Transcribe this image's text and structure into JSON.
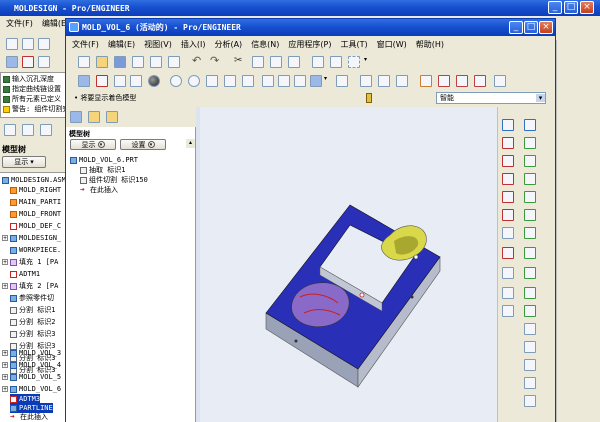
{
  "bg_window": {
    "title": "MOLDESIGN - Pro/ENGINEER",
    "menu": [
      "文件(F)",
      "编辑(E)"
    ],
    "messages": [
      "输入沉孔深度",
      "指定曲线链设置",
      "所有元素已定义",
      "警告: 组件切割完"
    ],
    "model_tree_label": "模型树",
    "show_label": "显示",
    "tree": [
      {
        "icon": "plane",
        "label": "MOLD_RIGHT"
      },
      {
        "icon": "plane",
        "label": "MAIN_PARTI"
      },
      {
        "icon": "plane",
        "label": "MOLD_FRONT"
      },
      {
        "icon": "axis",
        "label": "MOLD_DEF_C"
      },
      {
        "icon": "part",
        "label": "MOLDESIGN_"
      },
      {
        "icon": "part",
        "label": "WORKPIECE."
      },
      {
        "icon": "fill",
        "label": "填充 1 [PA"
      },
      {
        "icon": "axis",
        "label": "ADTM1"
      },
      {
        "icon": "fill",
        "label": "填充 2 [PA"
      },
      {
        "icon": "part",
        "label": "参照零件切"
      },
      {
        "icon": "cut",
        "label": "分割 标识1"
      },
      {
        "icon": "cut",
        "label": "分割 标识2"
      },
      {
        "icon": "cut",
        "label": "分割 标识3"
      },
      {
        "icon": "cut",
        "label": "分割 标识3"
      },
      {
        "icon": "cut",
        "label": "分割 标识3"
      },
      {
        "icon": "cut",
        "label": "分割 标识3"
      },
      {
        "icon": "part",
        "label": "MOLD_VOL_3"
      },
      {
        "icon": "part",
        "label": "MOLD_VOL_4"
      },
      {
        "icon": "part",
        "label": "MOLD_VOL_5"
      },
      {
        "icon": "part",
        "label": "MOLD_VOL_6"
      },
      {
        "icon": "axis",
        "label": "ADTM3"
      },
      {
        "icon": "part",
        "label": "PARTLINE"
      },
      {
        "icon": "arrow",
        "label": "在此插入"
      }
    ],
    "top_root": "MOLDESIGN.ASM"
  },
  "window": {
    "title": "MOLD_VOL_6 (活动的) - Pro/ENGINEER",
    "menu": [
      "文件(F)",
      "编辑(E)",
      "视图(V)",
      "插入(I)",
      "分析(A)",
      "信息(N)",
      "应用程序(P)",
      "工具(T)",
      "窗口(W)",
      "帮助(H)"
    ],
    "status_message": "• 将要显示着色模型",
    "filter_value": "智能",
    "model_tree_label": "模型树",
    "show_button": "显示",
    "settings_button": "设置",
    "tree": [
      {
        "icon": "part",
        "label": "MOLD_VOL_6.PRT",
        "indent": 0
      },
      {
        "icon": "cut",
        "label": "抽取 标识1",
        "indent": 1
      },
      {
        "icon": "cut",
        "label": "组件切割 标识150",
        "indent": 1
      },
      {
        "icon": "arrow",
        "label": "在此插入",
        "indent": 1
      }
    ]
  },
  "colors": {
    "title_blue": "#1850d0",
    "viewport_bg": "#e8ecf4",
    "model_top": "#2a2fb8",
    "model_side": "#a9b0c4",
    "accent_yellow": "#d8d84a",
    "accent_purple": "#8a6ac8"
  }
}
